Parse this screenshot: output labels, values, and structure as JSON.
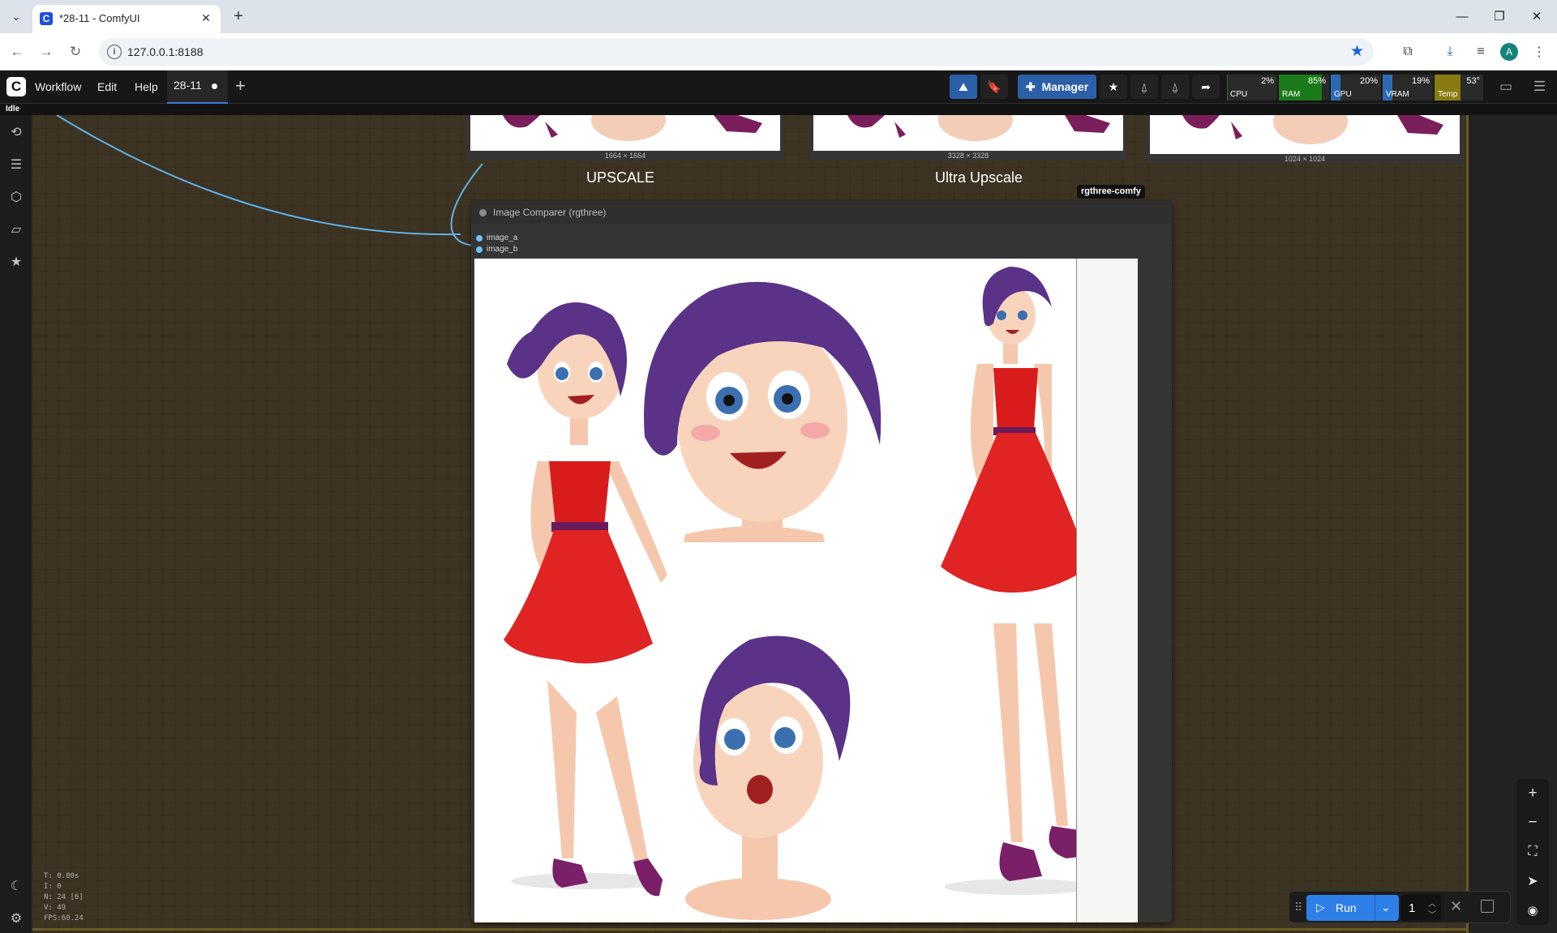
{
  "browser": {
    "tab_title": "*28-11 - ComfyUI",
    "favicon_letter": "C",
    "url": "127.0.0.1:8188",
    "profile_initial": "A"
  },
  "comfy": {
    "logo_letter": "C",
    "menu": [
      "Workflow",
      "Edit",
      "Help"
    ],
    "workflow_tab": "28-11",
    "manager_label": "Manager",
    "status": "Idle",
    "monitors": [
      {
        "label": "CPU",
        "value": "2%",
        "fraction": 0.02,
        "color": "#2e6b2e"
      },
      {
        "label": "RAM",
        "value": "85%",
        "fraction": 0.85,
        "color": "#1a7a1a"
      },
      {
        "label": "GPU",
        "value": "20%",
        "fraction": 0.2,
        "color": "#2e6ab3"
      },
      {
        "label": "VRAM",
        "value": "19%",
        "fraction": 0.19,
        "color": "#2e6ab3"
      },
      {
        "label": "Temp",
        "value": "53°",
        "fraction": 0.53,
        "color": "#8a7a12"
      }
    ]
  },
  "canvas": {
    "top_nodes": [
      {
        "dims": "1664 × 1664"
      },
      {
        "dims": "3328 × 3328"
      },
      {
        "dims": "1024 × 1024"
      }
    ],
    "group_labels": [
      "UPSCALE",
      "Ultra Upscale"
    ],
    "badge": "rgthree-comfy",
    "comparer": {
      "title": "Image Comparer (rgthree)",
      "inputs": [
        "image_a",
        "image_b"
      ]
    },
    "stats": [
      "T: 0.00s",
      "I: 0",
      "N: 24 [6]",
      "V: 49",
      "FPS:60.24"
    ]
  },
  "runbar": {
    "run_label": "Run",
    "batch_count": "1"
  }
}
